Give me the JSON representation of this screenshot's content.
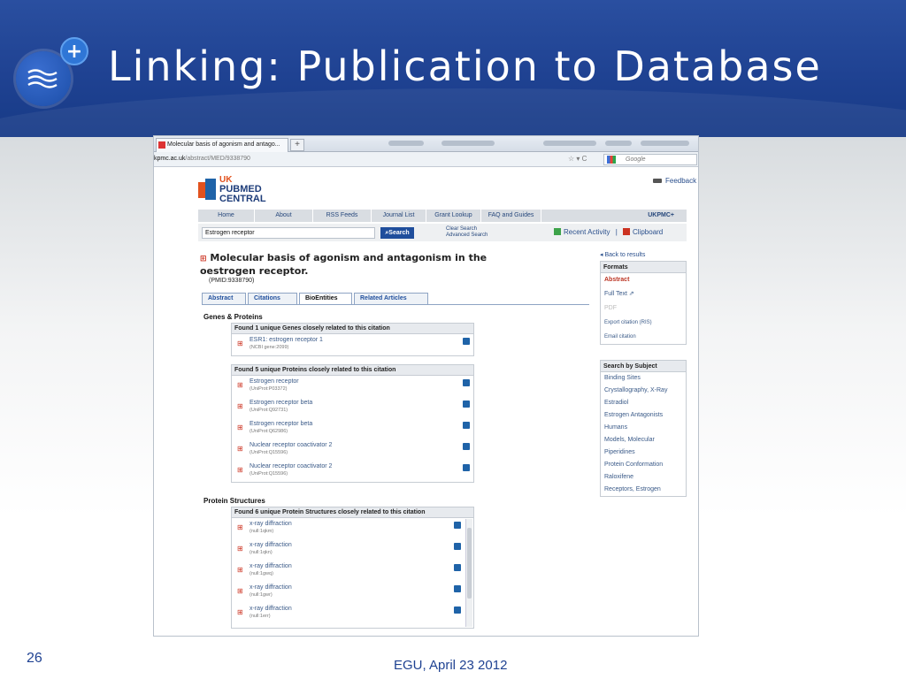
{
  "slide": {
    "title": "Linking: Publication to Database",
    "number": "26",
    "footer": "EGU, April 23 2012"
  },
  "browser": {
    "tab_title": "Molecular basis of agonism and antago...",
    "new_tab": "+",
    "url_domain": "kpmc.ac.uk",
    "url_path": "/abstract/MED/9338790",
    "search_engine_placeholder": "Google"
  },
  "ukpmc": {
    "logo": {
      "line1": "UK",
      "line2": "PUBMED",
      "line3": "CENTRAL"
    },
    "feedback": "Feedback",
    "menu": [
      "Home",
      "About",
      "RSS Feeds",
      "Journal List",
      "Grant Lookup",
      "FAQ and Guides"
    ],
    "menu_right": "UKPMC+",
    "search_value": "Estrogen receptor",
    "search_button": "Search",
    "clear_search": "Clear Search",
    "advanced_search": "Advanced Search",
    "recent_activity": "Recent Activity",
    "separator": "|",
    "clipboard": "Clipboard",
    "article_title": "Molecular basis of agonism and antagonism in the oestrogen receptor.",
    "pmid": "(PMID:9338790)",
    "tabs": [
      "Abstract",
      "Citations",
      "BioEntities",
      "Related Articles"
    ],
    "genes_heading": "Genes & Proteins",
    "genes_box": {
      "header": "Found 1 unique Genes closely related to this citation",
      "rows": [
        {
          "name": "ESR1: estrogen receptor 1",
          "id": "(NCBI gene:2099)"
        }
      ]
    },
    "proteins_box": {
      "header": "Found 5 unique Proteins closely related to this citation",
      "rows": [
        {
          "name": "Estrogen receptor",
          "id": "(UniProt:P03372)"
        },
        {
          "name": "Estrogen receptor beta",
          "id": "(UniProt:Q92731)"
        },
        {
          "name": "Estrogen receptor beta",
          "id": "(UniProt:Q62986)"
        },
        {
          "name": "Nuclear receptor coactivator 2",
          "id": "(UniProt:Q15596)"
        },
        {
          "name": "Nuclear receptor coactivator 2",
          "id": "(UniProt:Q15596)"
        }
      ]
    },
    "structures_heading": "Protein Structures",
    "structures_box": {
      "header": "Found 6 unique Protein Structures closely related to this citation",
      "rows": [
        {
          "name": "x-ray diffraction",
          "id": "(null:1qkm)"
        },
        {
          "name": "x-ray diffraction",
          "id": "(null:1qkn)"
        },
        {
          "name": "x-ray diffraction",
          "id": "(null:1gwq)"
        },
        {
          "name": "x-ray diffraction",
          "id": "(null:1gwr)"
        },
        {
          "name": "x-ray diffraction",
          "id": "(null:1err)"
        }
      ]
    },
    "back_to_results": "Back to results",
    "formats": {
      "header": "Formats",
      "abstract": "Abstract",
      "full_text": "Full Text",
      "pdf": "PDF",
      "export": "Export citation (RIS)",
      "email": "Email citation"
    },
    "subjects": {
      "header": "Search by Subject",
      "items": [
        "Binding Sites",
        "Crystallography, X-Ray",
        "Estradiol",
        "Estrogen Antagonists",
        "Humans",
        "Models, Molecular",
        "Piperidines",
        "Protein Conformation",
        "Raloxifene",
        "Receptors, Estrogen"
      ]
    }
  }
}
